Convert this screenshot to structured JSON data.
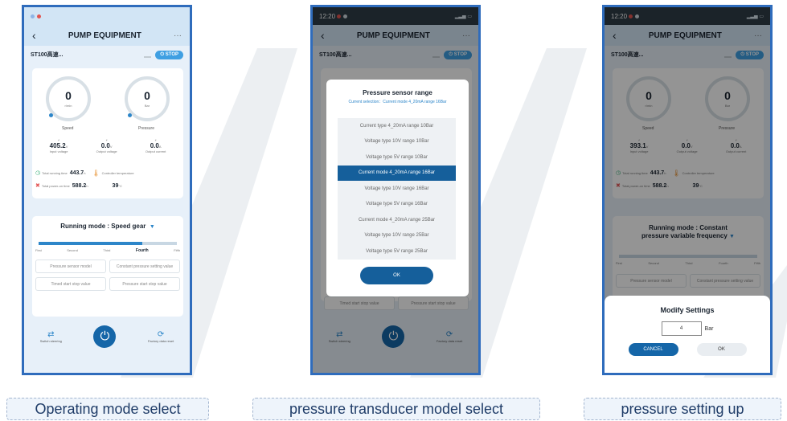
{
  "colors": {
    "accent": "#155f9b",
    "frame": "#2f6cbc",
    "status_bar": "#d2e5f5"
  },
  "screen1": {
    "title": "PUMP EQUIPMENT",
    "device": "ST100高速...",
    "stop": "STOP",
    "gauge_speed": {
      "value": "0",
      "unit": "r/min",
      "label": "Speed"
    },
    "gauge_pressure": {
      "value": "0",
      "unit": "Bar",
      "label": "Pressure"
    },
    "metrics": [
      {
        "value": "405.2",
        "unit": "V",
        "label": "Input voltage"
      },
      {
        "value": "0.0",
        "unit": "V",
        "label": "Output voltage"
      },
      {
        "value": "0.0",
        "unit": "A",
        "label": "Output current"
      }
    ],
    "running_time_label": "Total running time",
    "running_time": "443.7",
    "running_time_unit": "h",
    "temp_label": "Controller temperature",
    "temp": "39",
    "temp_unit": "°C",
    "power_on_label": "Total power-on time",
    "power_on": "588.2",
    "power_on_unit": "h",
    "mode": "Running mode : Speed gear",
    "gears": [
      "First",
      "Second",
      "Third",
      "Fourth",
      "Fifth"
    ],
    "active_gear": "Fourth",
    "gear_level": 0.75,
    "btn_sensor": "Pressure sensor model",
    "btn_constant": "Constant pressure setting value",
    "btn_timed": "Timed start stop value",
    "btn_pressure_ss": "Pressure start stop value",
    "switch": "Switch steering",
    "factory": "Factory data reset"
  },
  "screen2": {
    "time": "12:20",
    "title": "PUMP EQUIPMENT",
    "device": "ST100高速...",
    "stop": "STOP",
    "modal_title": "Pressure sensor range",
    "current": "Current selection：Current mode 4_20mA range 16Bar",
    "options": [
      "Current type 4_20mA range 10Bar",
      "Voltage type 10V range 10Bar",
      "Voltage type 5V range 10Bar",
      "Current mode 4_20mA range 16Bar",
      "Voltage type 10V range 16Bar",
      "Voltage type 5V range 16Bar",
      "Current mode 4_20mA range 25Bar",
      "Voltage type 10V range 25Bar",
      "Voltage type 5V range 25Bar"
    ],
    "selected_index": 3,
    "ok": "OK",
    "btn_timed": "Timed start stop value",
    "btn_pressure_ss": "Pressure start stop value",
    "switch": "Switch steering",
    "factory": "Factory data reset"
  },
  "screen3": {
    "time": "12:20",
    "title": "PUMP EQUIPMENT",
    "device": "ST100高速...",
    "stop": "STOP",
    "gauge_speed": {
      "value": "0",
      "unit": "r/min",
      "label": "Speed"
    },
    "gauge_pressure": {
      "value": "0",
      "unit": "Bar",
      "label": "Pressure"
    },
    "metrics": [
      {
        "value": "393.1",
        "unit": "V",
        "label": "Input voltage"
      },
      {
        "value": "0.0",
        "unit": "V",
        "label": "Output voltage"
      },
      {
        "value": "0.0",
        "unit": "A",
        "label": "Output current"
      }
    ],
    "running_time_label": "Total running time",
    "running_time": "443.7",
    "running_time_unit": "h",
    "temp_label": "Controller temperature",
    "temp": "39",
    "temp_unit": "°C",
    "power_on_label": "Total power-on time",
    "power_on": "588.2",
    "power_on_unit": "h",
    "mode": "Running mode : Constant pressure variable frequency",
    "gears": [
      "First",
      "Second",
      "Third",
      "Fourth",
      "Fifth"
    ],
    "btn_sensor": "Pressure sensor model",
    "btn_constant": "Constant pressure setting value",
    "sheet_title": "Modify Settings",
    "input_value": "4",
    "input_unit": "Bar",
    "cancel": "CANCEL",
    "ok": "OK"
  },
  "captions": [
    "Operating mode select",
    "pressure transducer model select",
    "pressure setting up"
  ]
}
